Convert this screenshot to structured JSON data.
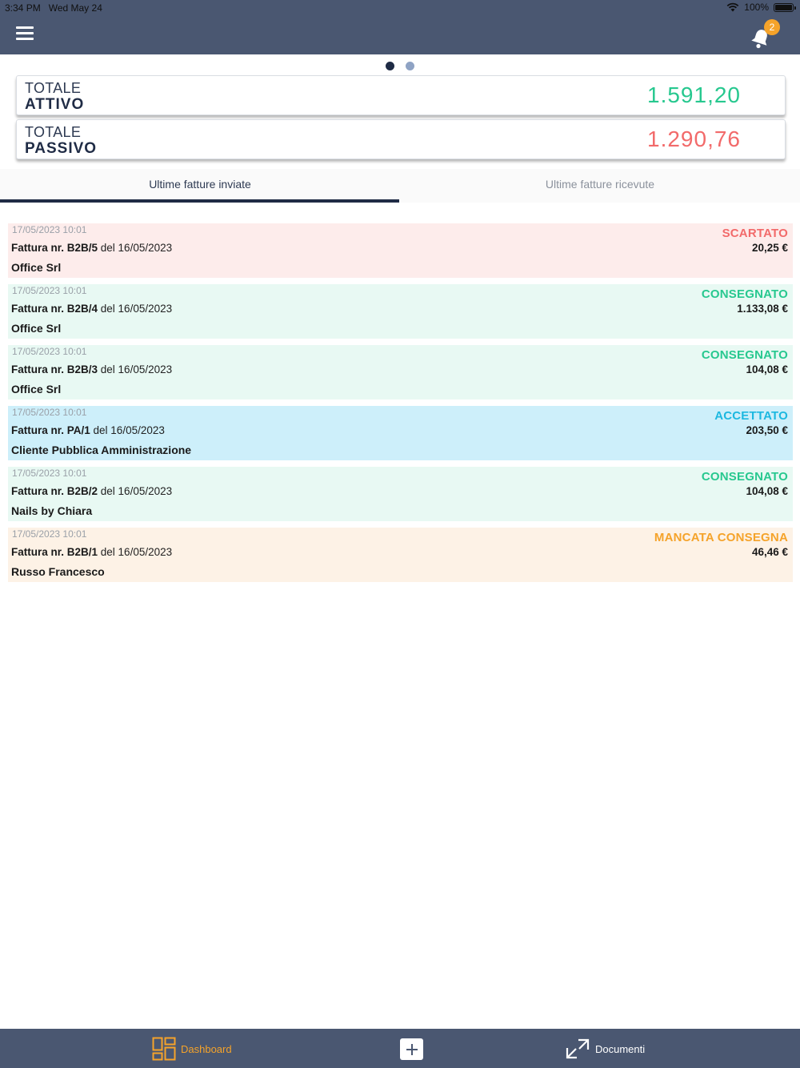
{
  "status_bar": {
    "time": "3:34 PM",
    "date": "Wed May 24",
    "battery": "100%"
  },
  "header": {
    "menu_icon": "hamburger-menu-icon",
    "notification_icon": "bell-icon",
    "notification_count": "2"
  },
  "pager": {
    "pages": 2,
    "active": 1
  },
  "totals": {
    "attivo": {
      "label_top": "TOTALE",
      "label_bottom": "ATTIVO",
      "amount": "1.591,20",
      "color": "#27c88f"
    },
    "passivo": {
      "label_top": "TOTALE",
      "label_bottom": "PASSIVO",
      "amount": "1.290,76",
      "color": "#f26a6a"
    }
  },
  "tabs": [
    {
      "label": "Ultime fatture inviate",
      "active": true
    },
    {
      "label": "Ultime fatture ricevute",
      "active": false
    }
  ],
  "invoices": [
    {
      "date": "17/05/2023 10:01",
      "doc_prefix": "Fattura nr. B2B/5",
      "doc_suffix": " del 16/05/2023",
      "client": "Office Srl",
      "status": "SCARTATO",
      "amount": "20,25 €",
      "bg": "#fdeceb",
      "status_color": "#f26a6a"
    },
    {
      "date": "17/05/2023 10:01",
      "doc_prefix": "Fattura nr. B2B/4",
      "doc_suffix": " del 16/05/2023",
      "client": "Office Srl",
      "status": "CONSEGNATO",
      "amount": "1.133,08 €",
      "bg": "#e8f9f3",
      "status_color": "#27c88f"
    },
    {
      "date": "17/05/2023 10:01",
      "doc_prefix": "Fattura nr. B2B/3",
      "doc_suffix": " del 16/05/2023",
      "client": "Office Srl",
      "status": "CONSEGNATO",
      "amount": "104,08 €",
      "bg": "#e8f9f3",
      "status_color": "#27c88f"
    },
    {
      "date": "17/05/2023 10:01",
      "doc_prefix": "Fattura nr. PA/1",
      "doc_suffix": " del 16/05/2023",
      "client": "Cliente Pubblica Amministrazione",
      "status": "ACCETTATO",
      "amount": "203,50 €",
      "bg": "#cdeffa",
      "status_color": "#1cb8e0"
    },
    {
      "date": "17/05/2023 10:01",
      "doc_prefix": "Fattura nr. B2B/2",
      "doc_suffix": " del 16/05/2023",
      "client": "Nails by Chiara",
      "status": "CONSEGNATO",
      "amount": "104,08 €",
      "bg": "#e8f9f3",
      "status_color": "#27c88f"
    },
    {
      "date": "17/05/2023 10:01",
      "doc_prefix": "Fattura nr. B2B/1",
      "doc_suffix": " del 16/05/2023",
      "client": "Russo Francesco",
      "status": "MANCATA CONSEGNA",
      "amount": "46,46 €",
      "bg": "#fdf2e6",
      "status_color": "#f5a32a"
    }
  ],
  "bottom_nav": {
    "dashboard_label": "Dashboard",
    "dashboard_icon": "dashboard-grid-icon",
    "add_icon": "plus-icon",
    "documents_label": "Documenti",
    "documents_icon": "arrows-exchange-icon",
    "active_color": "#f5a32a"
  }
}
